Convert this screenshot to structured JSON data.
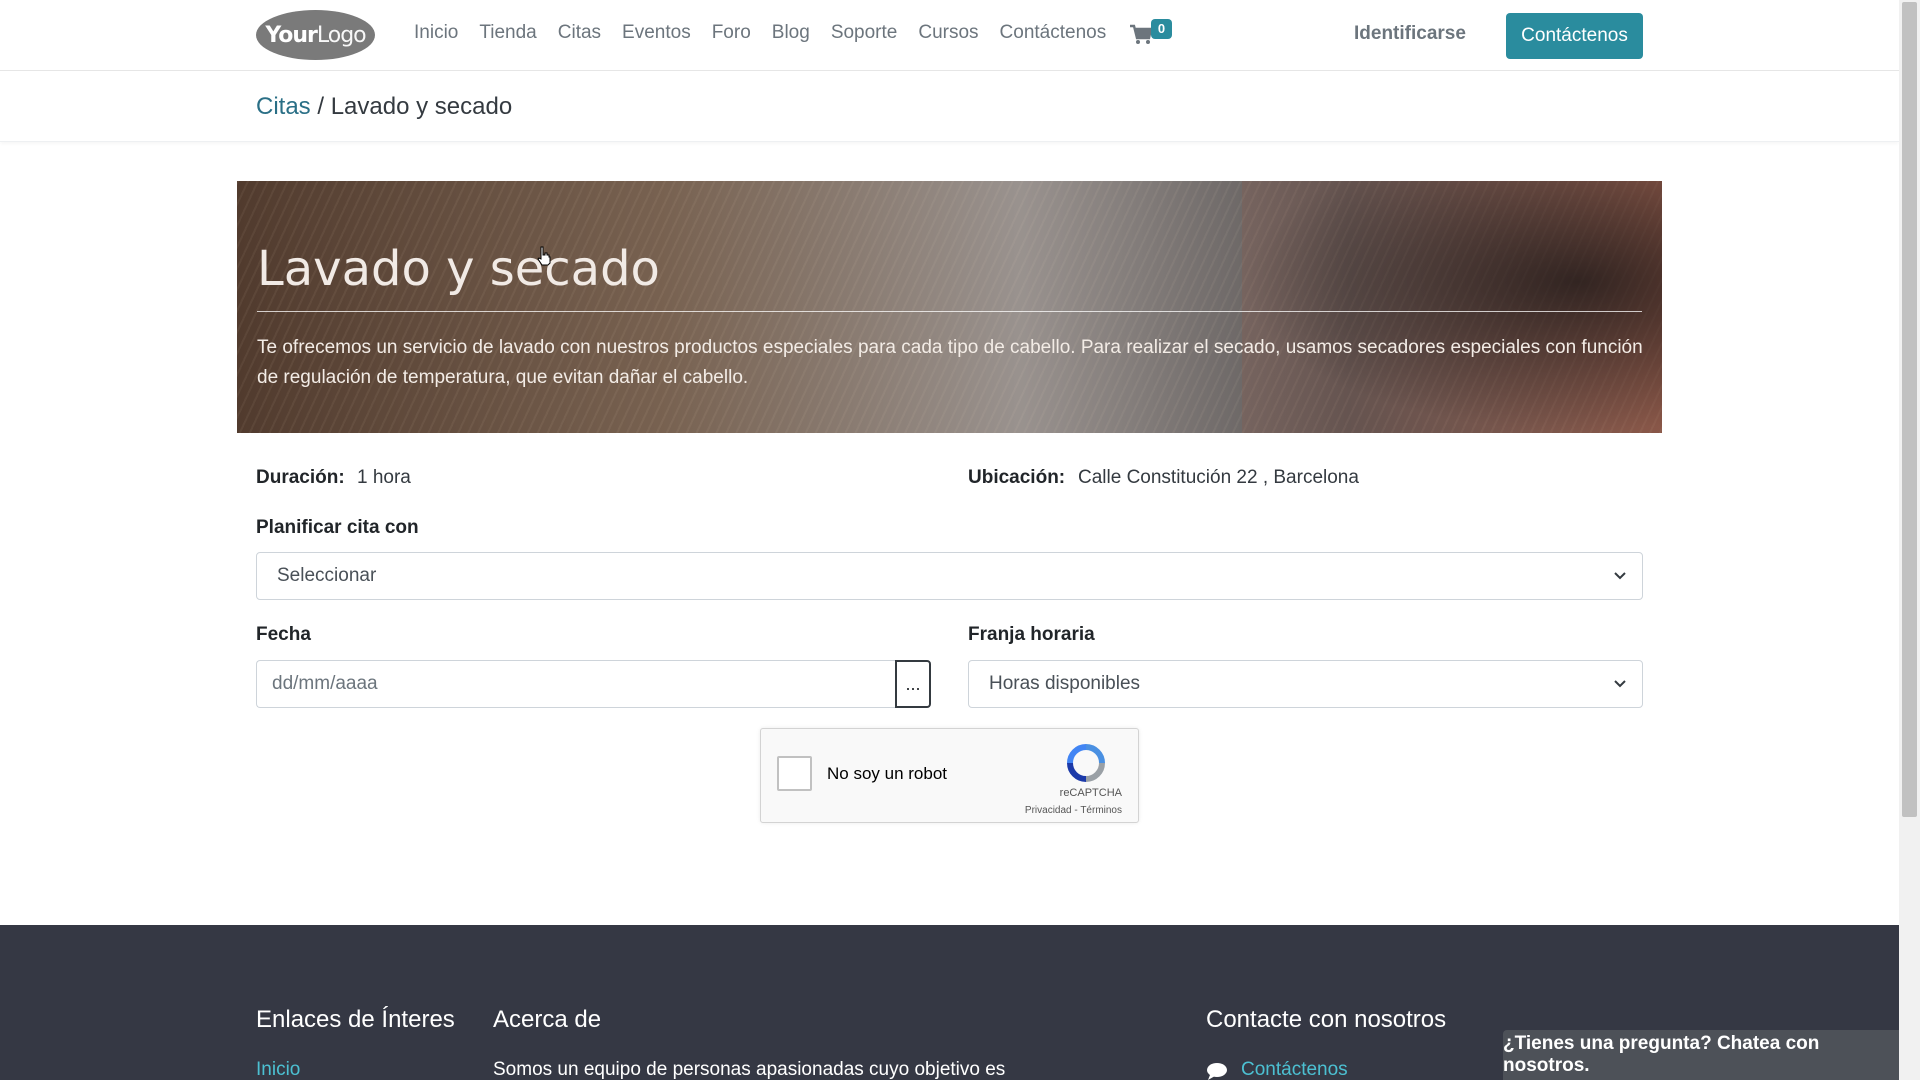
{
  "header": {
    "logo_bold": "Your",
    "logo_light": "Logo",
    "nav": [
      "Inicio",
      "Tienda",
      "Citas",
      "Eventos",
      "Foro",
      "Blog",
      "Soporte",
      "Cursos",
      "Contáctenos"
    ],
    "cart_count": "0",
    "signin": "Identificarse",
    "contact_button": "Contáctenos",
    "accent_color": "#2a8c9e"
  },
  "breadcrumb": {
    "parent": "Citas",
    "separator": " / ",
    "current": "Lavado y secado"
  },
  "hero": {
    "title": "Lavado y secado",
    "description": "Te ofrecemos un servicio de lavado con nuestros productos especiales para cada tipo de cabello. Para realizar el secado, usamos secadores especiales con función de regulación de temperatura, que evitan dañar el cabello."
  },
  "details": {
    "duration_label": "Duración:",
    "duration_value": "1 hora",
    "location_label": "Ubicación:",
    "location_value": "Calle Constitución 22 , Barcelona"
  },
  "form": {
    "staff_label": "Planificar cita con",
    "staff_select": "Seleccionar",
    "date_label": "Fecha",
    "date_placeholder": "dd/mm/aaaa",
    "date_button": "...",
    "slot_label": "Franja horaria",
    "slot_select": "Horas disponibles"
  },
  "captcha": {
    "text": "No soy un robot",
    "brand": "reCAPTCHA",
    "links": "Privacidad - Términos"
  },
  "footer": {
    "links_title": "Enlaces de Ínteres",
    "first_link": "Inicio",
    "about_title": "Acerca de",
    "about_text": "Somos un equipo de personas apasionadas cuyo objetivo es",
    "contact_title": "Contacte con nosotros",
    "contact_link": "Contáctenos"
  },
  "chat": {
    "label": "¿Tienes una pregunta? Chatea con nosotros."
  }
}
